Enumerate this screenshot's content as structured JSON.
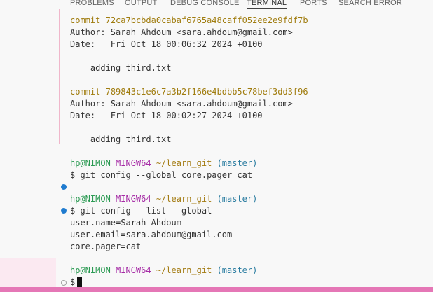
{
  "panel": {
    "tabs": [
      {
        "label": "PROBLEMS"
      },
      {
        "label": "OUTPUT"
      },
      {
        "label": "DEBUG CONSOLE"
      },
      {
        "label": "TERMINAL"
      },
      {
        "label": "PORTS"
      },
      {
        "label": "SEARCH ERROR"
      }
    ],
    "active_tab": "TERMINAL"
  },
  "terminal": {
    "commit1": {
      "label": "commit",
      "hash": "72ca7bcbda0cabaf6765a48caff052ee2e9fdf7b",
      "author": "Author: Sarah Ahdoum <sara.ahdoum@gmail.com>",
      "date": "Date:   Fri Oct 18 00:06:32 2024 +0100",
      "message": "    adding third.txt"
    },
    "commit2": {
      "label": "commit",
      "hash": "789843c1e6c7a3b2f166e4bdbb5c78bef3dd3f96",
      "author": "Author: Sarah Ahdoum <sara.ahdoum@gmail.com>",
      "date": "Date:   Fri Oct 18 00:02:27 2024 +0100",
      "message": "    adding third.txt"
    },
    "prompt": {
      "user_host": "hp@NIMON",
      "shell": "MINGW64",
      "path": "~/learn_git",
      "branch": "(master)"
    },
    "cmd1": "$ git config --global core.pager cat",
    "cmd2": "$ git config --list --global",
    "output": [
      "user.name=Sarah Ahdoum",
      "user.email=sara.ahdoum@gmail.com",
      "core.pager=cat"
    ],
    "final_prompt": "$"
  },
  "colors": {
    "user_host": "#2a9a52",
    "shell": "#a52aa5",
    "path": "#a37b12",
    "branch": "#2a7ca0",
    "hash": "#a07c0e",
    "decoration_dot": "#1f7bcf",
    "status_bar": "#e577b6"
  }
}
